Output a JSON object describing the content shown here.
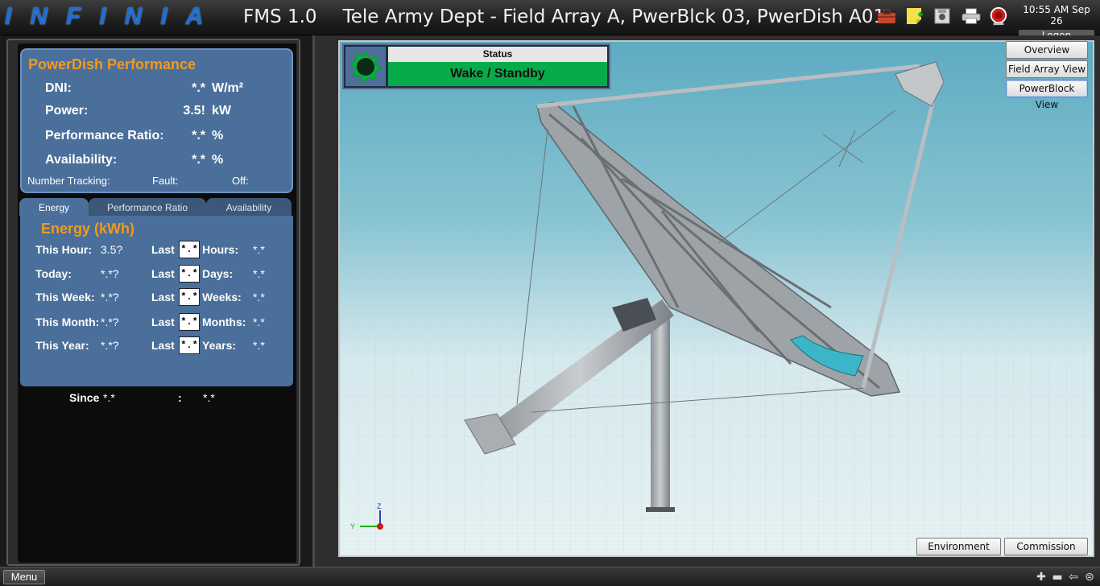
{
  "app": {
    "logo": "INFINIA",
    "name": "FMS 1.0",
    "location": "Tele Army Dept - Field Array A, PwerBlck 03, PwerDish A01"
  },
  "clock": {
    "time": "10:55 AM Sep 26",
    "logon": "Logon"
  },
  "toolbar_icons": [
    "toolbox-icon",
    "sticky-note-icon",
    "security-camera-icon",
    "printer-icon",
    "alarm-icon"
  ],
  "performance": {
    "title": "PowerDish Performance",
    "rows": [
      {
        "label": "DNI:",
        "value": "*.*",
        "unit": "W/m²"
      },
      {
        "label": "Power:",
        "value": "3.5!",
        "unit": "kW"
      },
      {
        "label": "Performance Ratio:",
        "value": "*.*",
        "unit": "%"
      },
      {
        "label": "Availability:",
        "value": "*.*",
        "unit": "%"
      }
    ],
    "number_tracking": "Number Tracking:",
    "fault": "Fault:",
    "off": "Off:"
  },
  "tabs": [
    "Energy",
    "Performance Ratio",
    "Availability"
  ],
  "energy": {
    "title": "Energy (kWh)",
    "rows": [
      {
        "label": "This Hour:",
        "value": "3.5?",
        "last": "Last",
        "box": "*.*",
        "period": "Hours:",
        "pvalue": "*.*"
      },
      {
        "label": "Today:",
        "value": "*.*?",
        "last": "Last",
        "box": "*.*",
        "period": "Days:",
        "pvalue": "*.*"
      },
      {
        "label": "This Week:",
        "value": "*.*?",
        "last": "Last",
        "box": "*.*",
        "period": "Weeks:",
        "pvalue": "*.*"
      },
      {
        "label": "This Month:",
        "value": "*.*?",
        "last": "Last",
        "box": "*.*",
        "period": "Months:",
        "pvalue": "*.*"
      },
      {
        "label": "This Year:",
        "value": "*.*?",
        "last": "Last",
        "box": "*.*",
        "period": "Years:",
        "pvalue": "*.*"
      }
    ],
    "since_label": "Since",
    "since_value": "*.*",
    "colon": ":",
    "since_total": "*.*"
  },
  "status": {
    "header": "Status",
    "value": "Wake / Standby",
    "color": "#08ab4a"
  },
  "view_buttons": {
    "overview": "Overview",
    "field_array": "Field Array View",
    "powerblock": "PowerBlock View",
    "environment": "Environment",
    "commission": "Commission"
  },
  "axis": {
    "z": "Z",
    "y": "Y"
  },
  "bottom": {
    "menu": "Menu"
  }
}
